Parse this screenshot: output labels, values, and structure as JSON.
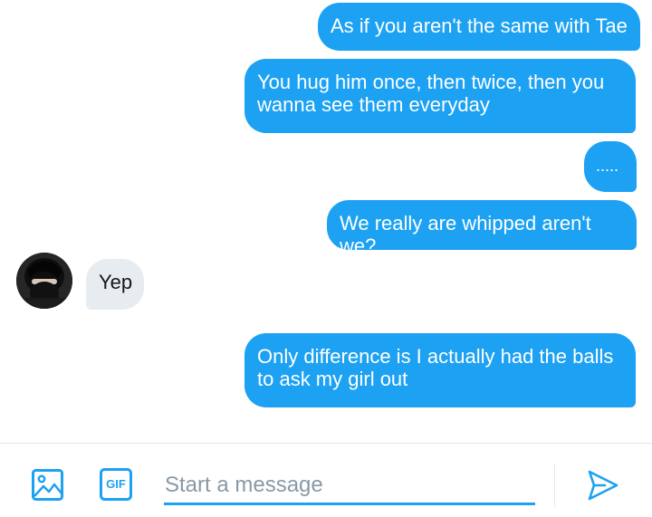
{
  "conversation": {
    "messages": [
      {
        "direction": "sent",
        "text": "As if you aren't the same with Tae"
      },
      {
        "direction": "sent",
        "text": "You hug him once, then twice, then you\nwanna see them everyday"
      },
      {
        "direction": "sent",
        "text": "....."
      },
      {
        "direction": "sent",
        "text": "We really are whipped aren't we?"
      },
      {
        "direction": "received",
        "text": "Yep"
      },
      {
        "direction": "sent",
        "text": "Only difference is I actually had the balls\nto ask my girl out"
      }
    ]
  },
  "composer": {
    "placeholder": "Start a message",
    "gif_label": "GIF",
    "icons": {
      "media": "image-icon",
      "gif": "gif-icon",
      "send": "send-icon"
    }
  },
  "colors": {
    "accent": "#1da1f2",
    "received_bubble": "#e6ecf0",
    "placeholder": "#8899a6",
    "divider": "#e1e8ed"
  }
}
